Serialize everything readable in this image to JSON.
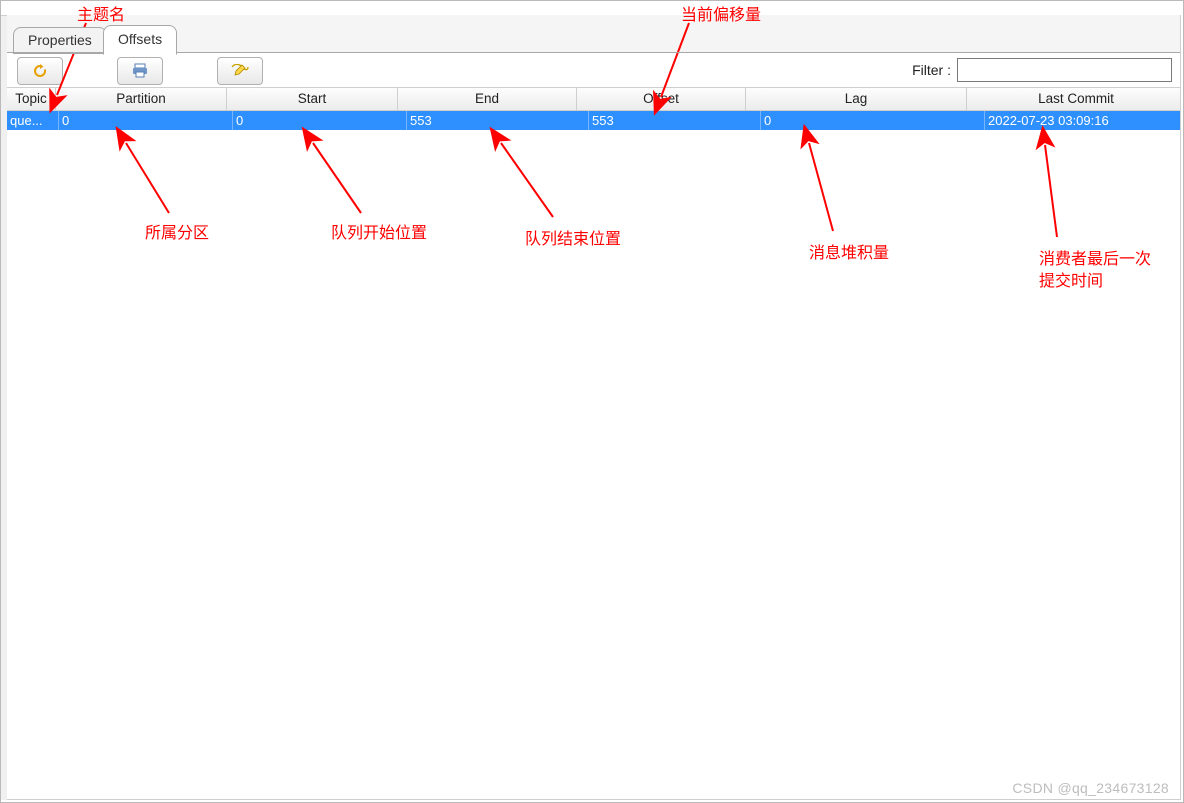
{
  "tabs": {
    "properties": "Properties",
    "offsets": "Offsets"
  },
  "toolbar": {
    "filter_label": "Filter :",
    "filter_value": ""
  },
  "columns": {
    "topic": "Topic",
    "partition": "Partition",
    "start": "Start",
    "end": "End",
    "offset": "Offset",
    "lag": "Lag",
    "last_commit": "Last Commit"
  },
  "rows": [
    {
      "topic": "que...",
      "partition": "0",
      "start": "0",
      "end": "553",
      "offset": "553",
      "lag": "0",
      "last_commit": "2022-07-23 03:09:16"
    }
  ],
  "annotations": {
    "topic_name": "主题名",
    "current_offset": "当前偏移量",
    "partition_owned": "所属分区",
    "queue_start": "队列开始位置",
    "queue_end": "队列结束位置",
    "msg_backlog": "消息堆积量",
    "last_commit_time_l1": "消费者最后一次",
    "last_commit_time_l2": "提交时间"
  },
  "watermark": "CSDN @qq_234673128",
  "chart_data": {
    "type": "table",
    "columns": [
      "Topic",
      "Partition",
      "Start",
      "End",
      "Offset",
      "Lag",
      "Last Commit"
    ],
    "rows": [
      [
        "que...",
        0,
        0,
        553,
        553,
        0,
        "2022-07-23 03:09:16"
      ]
    ]
  }
}
